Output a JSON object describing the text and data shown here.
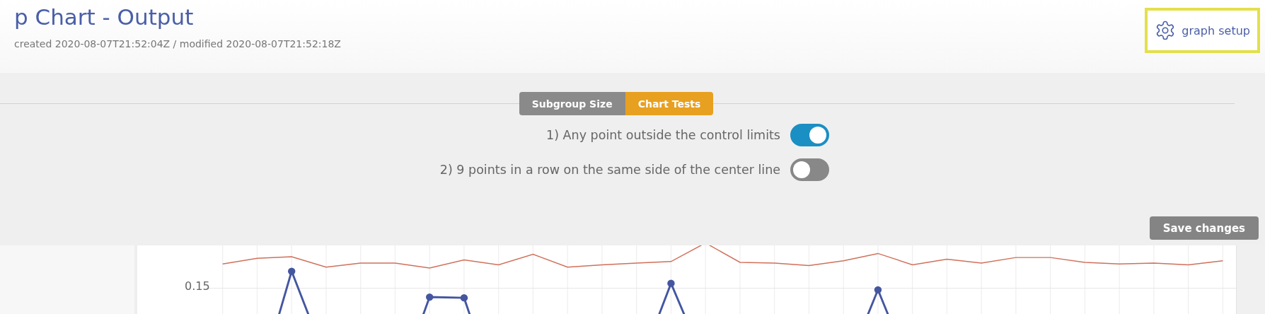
{
  "header": {
    "title": "p Chart - Output",
    "subtitle": "created 2020-08-07T21:52:04Z / modified 2020-08-07T21:52:18Z",
    "setup_button": "graph setup"
  },
  "tabs": [
    {
      "label": "Subgroup Size",
      "selected": false
    },
    {
      "label": "Chart Tests",
      "selected": true
    }
  ],
  "tests": [
    {
      "label": "1) Any point outside the control limits",
      "on": true
    },
    {
      "label": "2) 9 points in a row on the same side of the center line",
      "on": false
    }
  ],
  "save_button": "Save changes",
  "chart": {
    "y_tick": "0.15"
  }
}
